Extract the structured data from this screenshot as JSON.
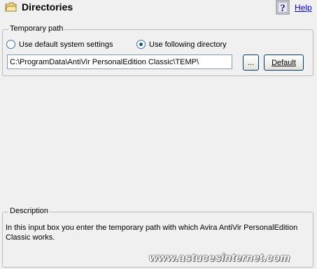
{
  "header": {
    "title": "Directories",
    "help_label": "Help",
    "folder_icon": "folder-icon",
    "help_icon": "help-question-icon"
  },
  "temporary_path": {
    "legend": "Temporary path",
    "option_default": "Use default system settings",
    "option_following": "Use following directory",
    "selected_option": "Use following directory",
    "path_value": "C:\\ProgramData\\AntiVir PersonalEdition Classic\\TEMP\\",
    "browse_label": "...",
    "default_label": "Default"
  },
  "description": {
    "legend": "Description",
    "text": "In this input box you enter the temporary path with which Avira AntiVir PersonalEdition Classic works."
  },
  "watermark": "www.astucesinternet.com",
  "colors": {
    "background": "#f0f0f0",
    "link": "#0000cc",
    "border": "#b9b9b9"
  }
}
